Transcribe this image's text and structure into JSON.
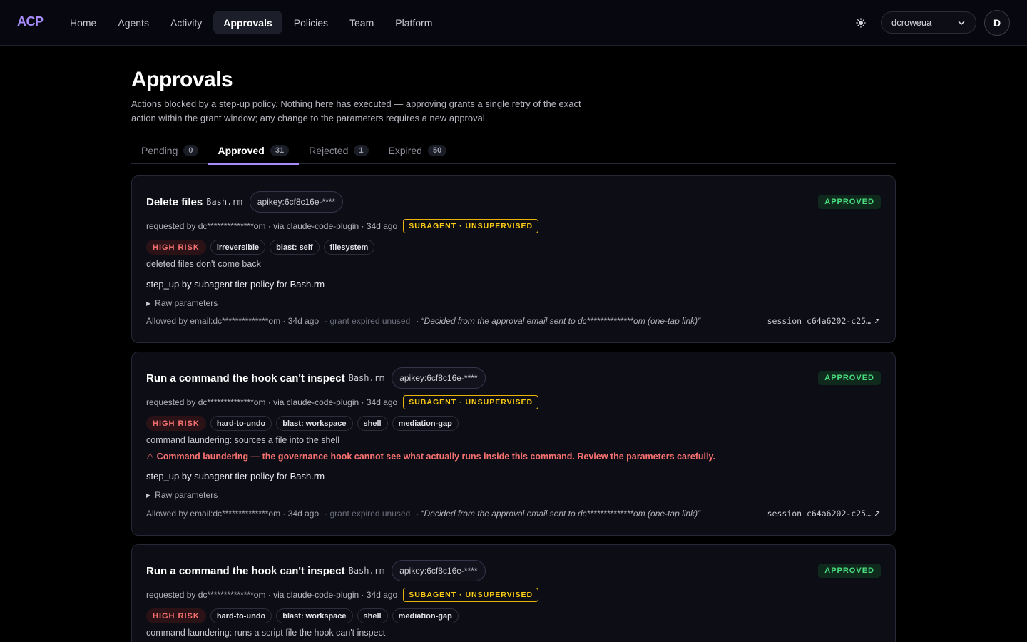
{
  "nav": {
    "logo": "ACP",
    "items": [
      "Home",
      "Agents",
      "Activity",
      "Approvals",
      "Policies",
      "Team",
      "Platform"
    ],
    "active": "Approvals",
    "org": "dcroweua",
    "avatar_initial": "D"
  },
  "header": {
    "title": "Approvals",
    "description": "Actions blocked by a step-up policy. Nothing here has executed — approving grants a single retry of the exact action within the grant window; any change to the parameters requires a new approval."
  },
  "tabs": [
    {
      "label": "Pending",
      "count": "0"
    },
    {
      "label": "Approved",
      "count": "31"
    },
    {
      "label": "Rejected",
      "count": "1"
    },
    {
      "label": "Expired",
      "count": "50"
    }
  ],
  "active_tab": "Approved",
  "colors": {
    "accent": "#a78bfa",
    "approved": "#4ade80",
    "risk": "#f87171",
    "subagent": "#facc15"
  },
  "cards": [
    {
      "title": "Delete files",
      "tool": "Bash.rm",
      "key": "apikey:6cf8c16e-****",
      "status": "APPROVED",
      "meta": "requested by dc**************om · via claude-code-plugin · 34d ago",
      "subagent": "SUBAGENT · UNSUPERVISED",
      "risk": "HIGH RISK",
      "tags": [
        "irreversible",
        "blast: self",
        "filesystem"
      ],
      "reason": "deleted files don't come back",
      "warning": "",
      "policy": "step_up by subagent tier policy for Bash.rm",
      "raw_label": "Raw parameters",
      "allowed": "Allowed by email:dc**************om · 34d ago",
      "grant": "· grant expired unused",
      "quote": "· “Decided from the approval email sent to dc**************om (one-tap link)”",
      "session": "session c64a6202-c25…"
    },
    {
      "title": "Run a command the hook can't inspect",
      "tool": "Bash.rm",
      "key": "apikey:6cf8c16e-****",
      "status": "APPROVED",
      "meta": "requested by dc**************om · via claude-code-plugin · 34d ago",
      "subagent": "SUBAGENT · UNSUPERVISED",
      "risk": "HIGH RISK",
      "tags": [
        "hard-to-undo",
        "blast: workspace",
        "shell",
        "mediation-gap"
      ],
      "reason": "command laundering: sources a file into the shell",
      "warning": "⚠ Command laundering — the governance hook cannot see what actually runs inside this command. Review the parameters carefully.",
      "policy": "step_up by subagent tier policy for Bash.rm",
      "raw_label": "Raw parameters",
      "allowed": "Allowed by email:dc**************om · 34d ago",
      "grant": "· grant expired unused",
      "quote": "· “Decided from the approval email sent to dc**************om (one-tap link)”",
      "session": "session c64a6202-c25…"
    },
    {
      "title": "Run a command the hook can't inspect",
      "tool": "Bash.rm",
      "key": "apikey:6cf8c16e-****",
      "status": "APPROVED",
      "meta": "requested by dc**************om · via claude-code-plugin · 34d ago",
      "subagent": "SUBAGENT · UNSUPERVISED",
      "risk": "HIGH RISK",
      "tags": [
        "hard-to-undo",
        "blast: workspace",
        "shell",
        "mediation-gap"
      ],
      "reason": "command laundering: runs a script file the hook can't inspect"
    }
  ]
}
